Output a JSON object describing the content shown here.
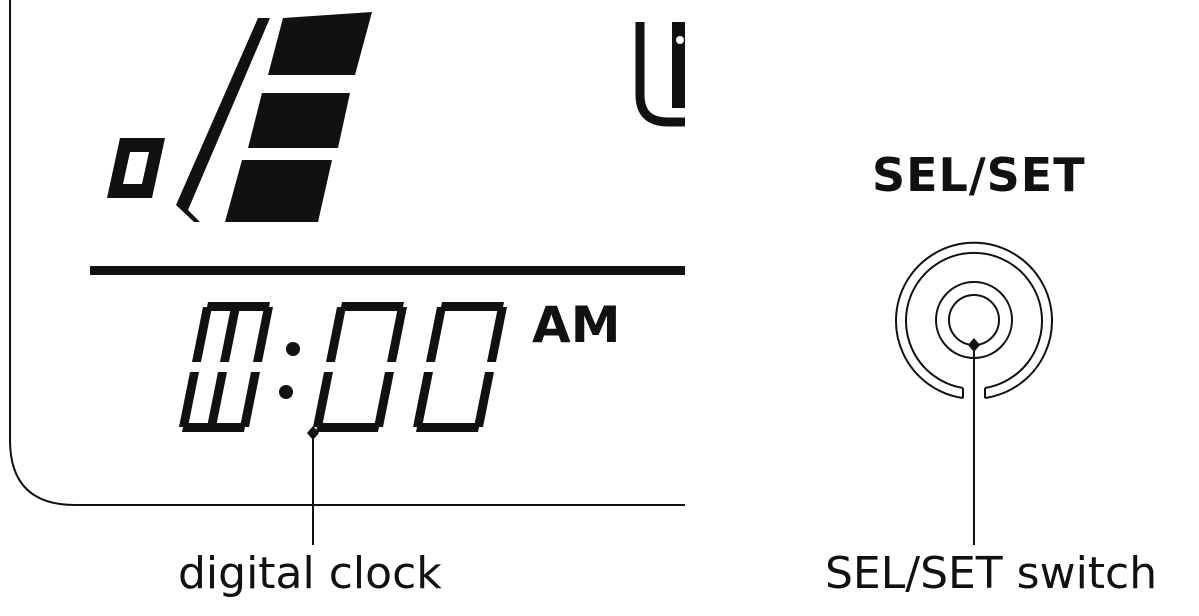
{
  "display": {
    "clock_digits": [
      "1",
      "0",
      "0",
      "0"
    ],
    "am_pm": "AM",
    "ink_color": "#111111"
  },
  "switch": {
    "title": "SEL/SET"
  },
  "callouts": {
    "clock_label": "digital clock",
    "switch_label": "SEL/SET switch"
  }
}
